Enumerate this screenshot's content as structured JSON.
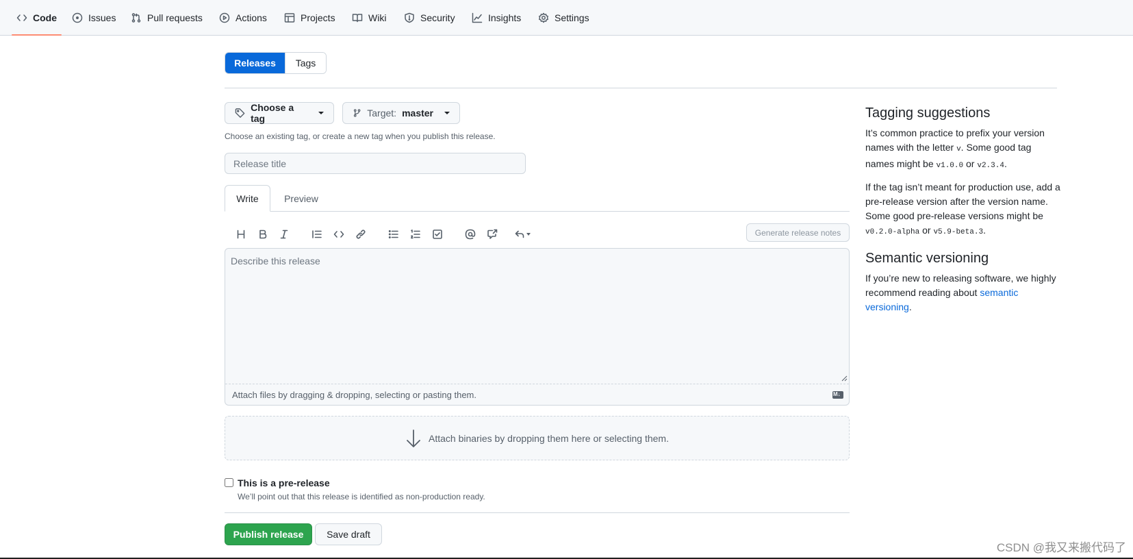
{
  "nav": {
    "items": [
      {
        "label": "Code",
        "icon": "code-icon"
      },
      {
        "label": "Issues",
        "icon": "issue-opened-icon"
      },
      {
        "label": "Pull requests",
        "icon": "git-pull-request-icon"
      },
      {
        "label": "Actions",
        "icon": "play-icon"
      },
      {
        "label": "Projects",
        "icon": "table-icon"
      },
      {
        "label": "Wiki",
        "icon": "book-icon"
      },
      {
        "label": "Security",
        "icon": "shield-icon"
      },
      {
        "label": "Insights",
        "icon": "graph-icon"
      },
      {
        "label": "Settings",
        "icon": "gear-icon"
      }
    ],
    "active": "Code"
  },
  "tabs": {
    "releases": "Releases",
    "tags": "Tags"
  },
  "form": {
    "tag_button": "Choose a tag",
    "target_label": "Target:",
    "target_branch": "master",
    "hint": "Choose an existing tag, or create a new tag when you publish this release.",
    "title_placeholder": "Release title",
    "write_tab": "Write",
    "preview_tab": "Preview",
    "generate_notes": "Generate release notes",
    "body_placeholder": "Describe this release",
    "attach_files": "Attach files by dragging & dropping, selecting or pasting them.",
    "attach_binaries": "Attach binaries by dropping them here or selecting them.",
    "prerelease_label": "This is a pre-release",
    "prerelease_note": "We’ll point out that this release is identified as non-production ready.",
    "publish": "Publish release",
    "save_draft": "Save draft"
  },
  "toolbar": [
    "heading-icon",
    "bold-icon",
    "italic-icon",
    "quote-icon",
    "code-icon",
    "link-icon",
    "unordered-list-icon",
    "ordered-list-icon",
    "tasklist-icon",
    "mention-icon",
    "cross-reference-icon",
    "reply-icon"
  ],
  "sidebar": {
    "tagging_title": "Tagging suggestions",
    "tagging_p1_a": "It’s common practice to prefix your version names with the letter ",
    "tagging_p1_code_v": "v",
    "tagging_p1_b": ". Some good tag names might be ",
    "tagging_p1_code1": "v1.0.0",
    "tagging_p1_or": " or ",
    "tagging_p1_code2": "v2.3.4",
    "tagging_p1_end": ".",
    "tagging_p2_a": "If the tag isn’t meant for production use, add a pre-release version after the version name. Some good pre-release versions might be ",
    "tagging_p2_code1": "v0.2.0-alpha",
    "tagging_p2_or": " or ",
    "tagging_p2_code2": "v5.9-beta.3",
    "tagging_p2_end": ".",
    "semver_title": "Semantic versioning",
    "semver_p_a": "If you’re new to releasing software, we highly recommend reading about ",
    "semver_link": "semantic versioning",
    "semver_p_end": "."
  },
  "watermark": "CSDN @我又来搬代码了",
  "colors": {
    "accent": "#0969da",
    "publish": "#2da44e",
    "active_underline": "#fd8c73"
  }
}
